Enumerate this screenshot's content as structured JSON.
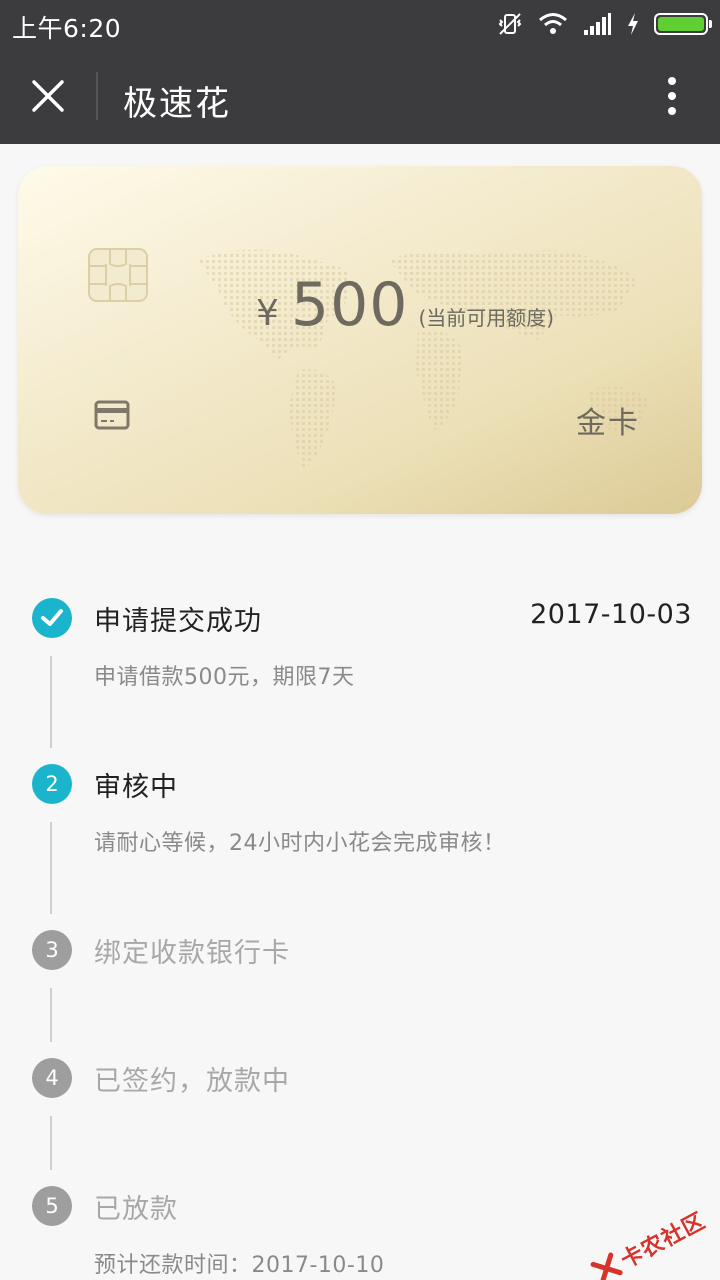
{
  "status_bar": {
    "time": "上午6:20"
  },
  "app_bar": {
    "title": "极速花"
  },
  "card": {
    "currency": "¥",
    "amount": "500",
    "amount_note": "(当前可用额度)",
    "tier": "金卡"
  },
  "steps": [
    {
      "number": "",
      "title": "申请提交成功",
      "date": "2017-10-03",
      "desc": "申请借款500元，期限7天",
      "state": "done"
    },
    {
      "number": "2",
      "title": "审核中",
      "desc": "请耐心等候，24小时内小花会完成审核！",
      "state": "active"
    },
    {
      "number": "3",
      "title": "绑定收款银行卡",
      "state": "pending"
    },
    {
      "number": "4",
      "title": "已签约，放款中",
      "state": "pending"
    },
    {
      "number": "5",
      "title": "已放款",
      "desc": "预计还款时间：2017-10-10",
      "state": "pending"
    }
  ],
  "watermark": {
    "text": "卡农社区"
  },
  "colors": {
    "active": "#1ab4cc",
    "inactive": "#9e9e9e",
    "appbar": "#3c3c3e",
    "battery": "#5fcf34"
  }
}
